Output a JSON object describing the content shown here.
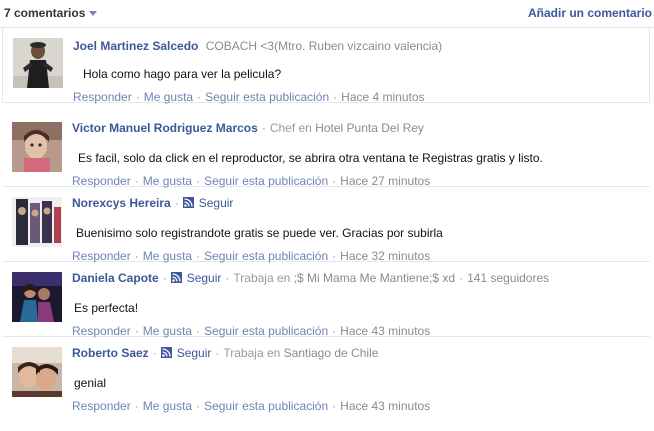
{
  "header": {
    "comment_count": "7 comentarios",
    "add_comment": "Añadir un comentario"
  },
  "actions": {
    "reply": "Responder",
    "like": "Me gusta",
    "follow_post": "Seguir esta publicación",
    "separator": "·"
  },
  "comments": [
    {
      "author": "Joel Martinez Salcedo",
      "meta": "COBACH <3(Mtro. Ruben vizcaino valencia)",
      "text": "Hola como hago para ver la pelicula?",
      "time": "Hace 4 minutos"
    },
    {
      "author": "Victor Manuel Rodriguez Marcos",
      "meta_prefix": "Chef en",
      "meta_place": "Hotel Punta Del Rey",
      "text": "Es facil, solo da click en el reproductor, se abrira otra ventana  te Registras gratis  y listo.",
      "time": "Hace 27 minutos"
    },
    {
      "author": "Norexcys Hereira",
      "follow": "Seguir",
      "text": "Buenisimo solo registrandote gratis se puede ver. Gracias por subirla",
      "time": "Hace 32 minutos"
    },
    {
      "author": "Daniela Capote",
      "follow": "Seguir",
      "work_prefix": "Trabaja en",
      "work_place": ";$ Mi Mama Me Mantiene;$ xd",
      "followers": "141 seguidores",
      "text": "Es perfecta!",
      "time": "Hace 43 minutos"
    },
    {
      "author": "Roberto Saez",
      "follow": "Seguir",
      "work_prefix": "Trabaja en",
      "work_place": "Santiago de Chile",
      "text": "genial",
      "time": "Hace 43 minutos"
    }
  ],
  "colors": {
    "link": "#3b5998",
    "action": "#6d84b4",
    "muted": "#999999",
    "divider": "#e5e7ec"
  },
  "icons": {
    "caret": "chevron-down-icon",
    "follow": "rss-icon"
  }
}
